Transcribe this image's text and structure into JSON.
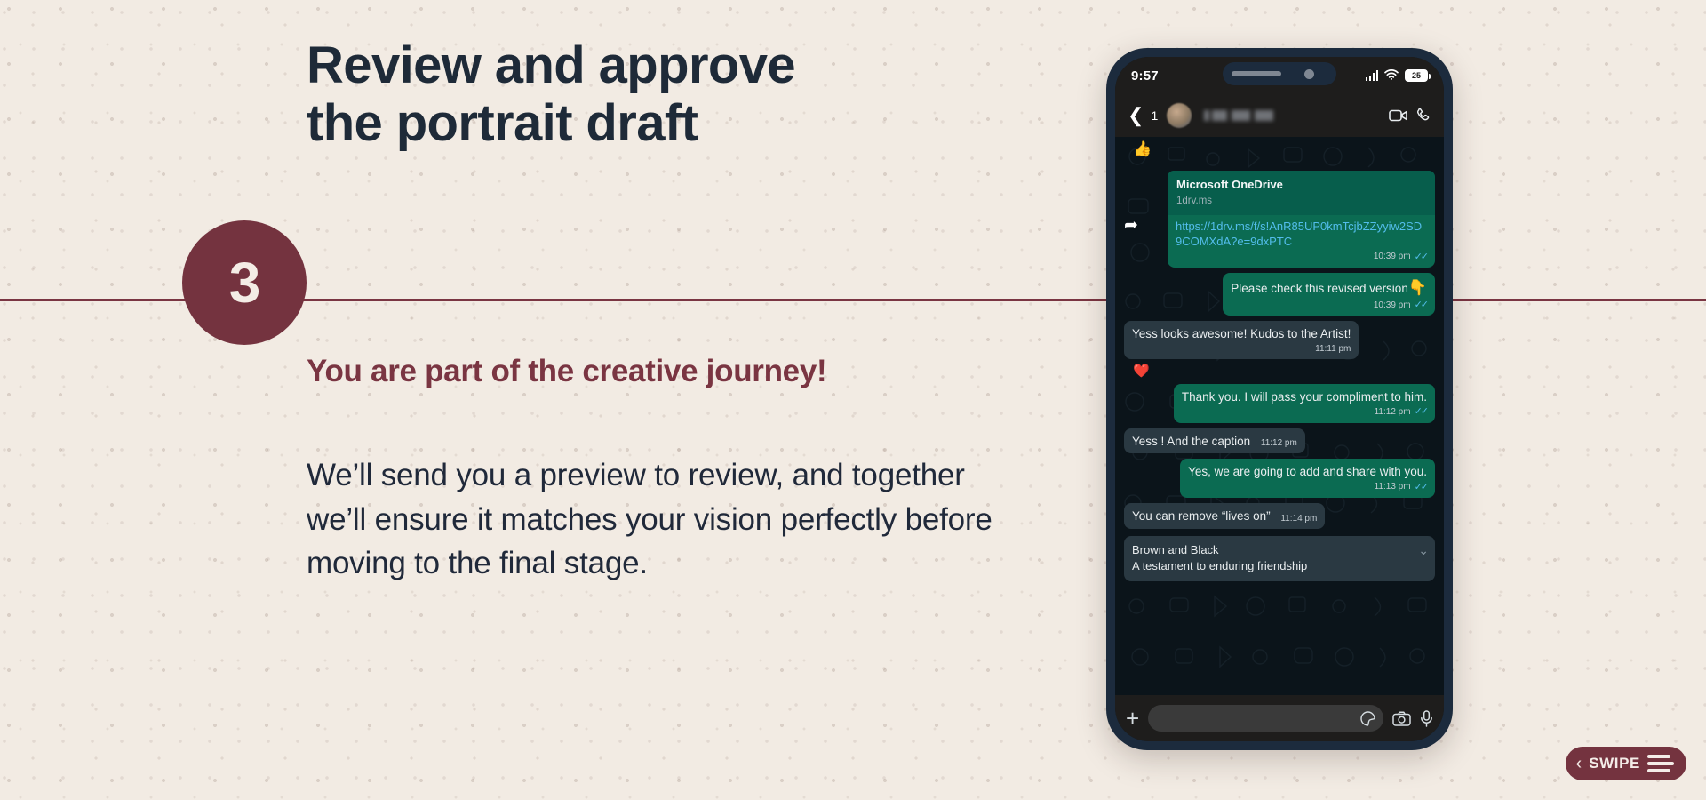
{
  "slide": {
    "title": "Review and approve\nthe portrait draft",
    "step_number": "3",
    "subtitle": "You are part of the creative journey!",
    "body": "We’ll send you a preview to review, and together we’ll ensure it matches your vision perfectly before moving to the final stage.",
    "colors": {
      "background": "#F2EBE3",
      "accent_maroon": "#74333F",
      "title_navy": "#1E2A38",
      "rule": "#7A3542"
    }
  },
  "swipe_button": {
    "label": "SWIPE",
    "chevron": "‹",
    "menu_icon": "hamburger-icon"
  },
  "phone": {
    "status_bar": {
      "time": "9:57",
      "battery_percent": "25",
      "signal_icon": "signal-bars-icon",
      "wifi_icon": "wifi-icon"
    },
    "chat_header": {
      "back_icon": "chevron-left-icon",
      "unread_count": "1",
      "contact_name": "",
      "avatar": "contact-avatar",
      "video_call_icon": "video-camera-icon",
      "voice_call_icon": "phone-icon"
    },
    "messages": [
      {
        "id": "reaction-thumbsup-top",
        "type": "reaction",
        "emoji": "👍"
      },
      {
        "id": "onedrive-link",
        "direction": "out",
        "forwarded": true,
        "link_card": {
          "title": "Microsoft OneDrive",
          "domain": "1drv.ms"
        },
        "text": "https://1drv.ms/f/s!AnR85UP0kmTcjbZZyyiw2SD9COMXdA?e=9dxPTC",
        "time": "10:39 pm",
        "status": "read"
      },
      {
        "id": "please-check",
        "direction": "out",
        "text": "Please check this revised version",
        "emoji": "👇",
        "time": "10:39 pm",
        "status": "read"
      },
      {
        "id": "looks-awesome",
        "direction": "in",
        "text": "Yess looks awesome! Kudos to the Artist!",
        "time": "11:11 pm"
      },
      {
        "id": "reaction-heart",
        "type": "reaction",
        "emoji": "❤️"
      },
      {
        "id": "thank-you",
        "direction": "out",
        "text": "Thank you. I will pass your compliment to him.",
        "time": "11:12 pm",
        "status": "read"
      },
      {
        "id": "and-the-caption",
        "direction": "in",
        "text": "Yess ! And the caption",
        "time": "11:12 pm"
      },
      {
        "id": "add-and-share",
        "direction": "out",
        "text": "Yes, we are going to add and share with you.",
        "time": "11:13 pm",
        "status": "read"
      },
      {
        "id": "remove-lives-on",
        "direction": "in",
        "text": "You can remove “lives on”",
        "time": "11:14 pm"
      },
      {
        "id": "caption-draft",
        "direction": "in",
        "line1": "Brown and Black",
        "line2": "A testament to enduring friendship",
        "expand_icon": "chevron-down-icon"
      }
    ],
    "input_bar": {
      "attach_icon": "plus-icon",
      "placeholder": "",
      "sticker_icon": "sticker-icon",
      "camera_icon": "camera-icon",
      "mic_icon": "microphone-icon"
    }
  }
}
